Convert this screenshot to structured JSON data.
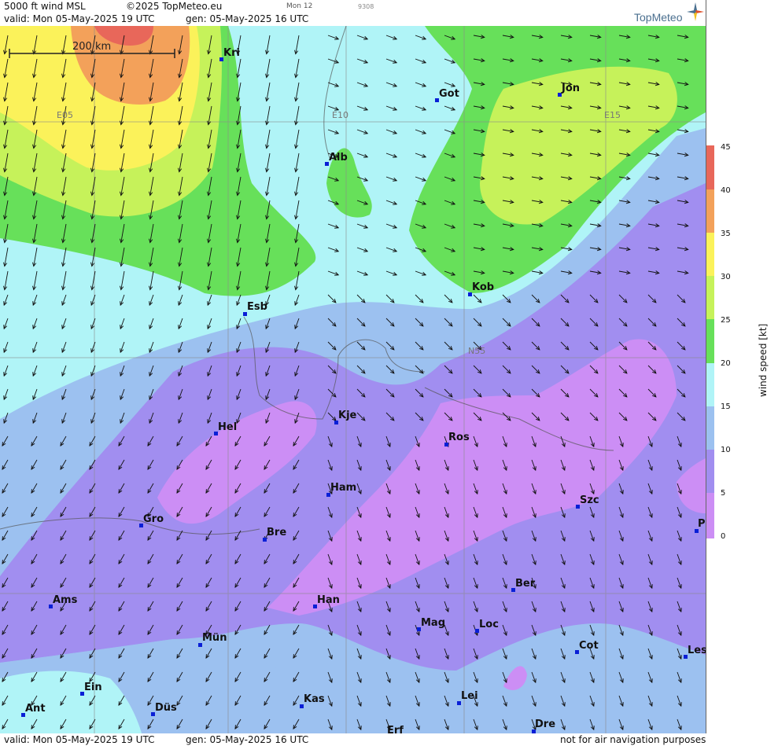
{
  "header": {
    "product": "5000 ft wind MSL",
    "copyright": "©2025 TopMeteo.eu",
    "run_code": "Mon 12",
    "code2": "9308",
    "valid": "valid:  Mon  05-May-2025  19 UTC",
    "generated": "gen: 05-May-2025 16 UTC",
    "brand": "TopMeteo"
  },
  "footer": {
    "valid": "valid:  Mon  05-May-2025  19 UTC",
    "generated": "gen: 05-May-2025 16 UTC",
    "disclaimer": "not for air navigation purposes"
  },
  "scale": {
    "label": "200 km"
  },
  "grid_labels": {
    "e05": "E05",
    "e10": "E10",
    "e15": "E15",
    "n55": "N55"
  },
  "colorbar": {
    "title": "wind speed [kt]",
    "ticks": [
      "45",
      "40",
      "35",
      "30",
      "25",
      "20",
      "15",
      "10",
      "5",
      "0"
    ],
    "colors": {
      "s40_45": "#e8675a",
      "s35_40": "#f3a15a",
      "s30_35": "#fbf25a",
      "s25_30": "#c6f25a",
      "s20_25": "#67e05a",
      "s15_20": "#b0f4f7",
      "s10_15": "#9cc1f0",
      "s5_10": "#a18ef0",
      "s0_5": "#cc8ef5"
    }
  },
  "cities": {
    "kri": "Kri",
    "got": "Got",
    "jon": "Jon",
    "alb": "Alb",
    "esb": "Esb",
    "kob": "Kob",
    "kje": "Kje",
    "hel": "Hel",
    "ros": "Ros",
    "ham": "Ham",
    "szc": "Szc",
    "gro": "Gro",
    "bre": "Bre",
    "p": "P",
    "ber": "Ber",
    "ams": "Ams",
    "han": "Han",
    "mag": "Mag",
    "loc": "Loc",
    "mun": "Mün",
    "cot": "Cot",
    "les": "Les",
    "ein": "Ein",
    "lei": "Lei",
    "kas": "Kas",
    "ant": "Ant",
    "dus": "Düs",
    "dre": "Dre",
    "erf": "Erf"
  }
}
